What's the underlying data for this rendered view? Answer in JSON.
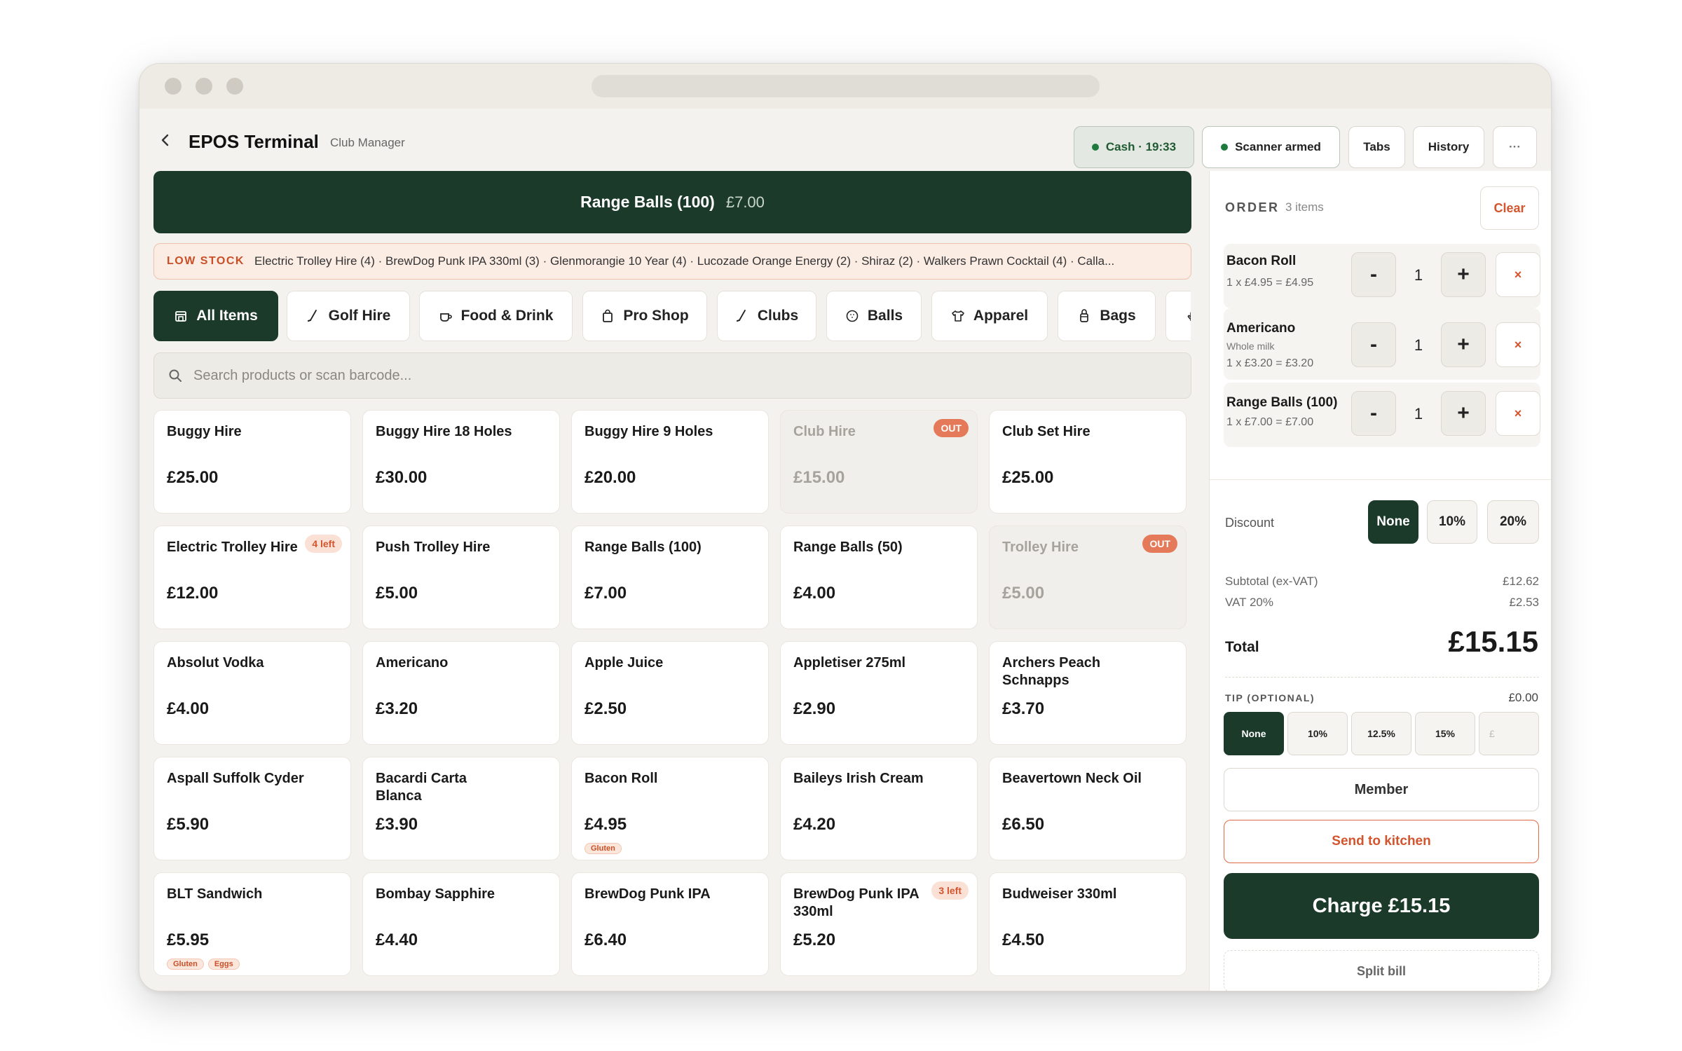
{
  "header": {
    "title": "EPOS Terminal",
    "subtitle": "Club Manager",
    "cash_status": "Cash · 19:33",
    "scanner_status": "Scanner armed",
    "tabs_label": "Tabs",
    "history_label": "History",
    "more_label": "···"
  },
  "hero": {
    "name": "Range Balls (100)",
    "price": "£7.00"
  },
  "low_stock": {
    "label": "LOW STOCK",
    "text": "Electric Trolley Hire (4) · BrewDog Punk IPA 330ml (3) · Glenmorangie 10 Year (4) · Lucozade Orange Energy (2) · Shiraz (2) · Walkers Prawn Cocktail (4) · Calla..."
  },
  "categories": [
    {
      "label": "All Items",
      "icon": "store-icon"
    },
    {
      "label": "Golf Hire",
      "icon": "golf-club-icon"
    },
    {
      "label": "Food & Drink",
      "icon": "cup-icon"
    },
    {
      "label": "Pro Shop",
      "icon": "shopping-bag-icon"
    },
    {
      "label": "Clubs",
      "icon": "golf-club-icon"
    },
    {
      "label": "Balls",
      "icon": "golf-ball-icon"
    },
    {
      "label": "Apparel",
      "icon": "shirt-icon"
    },
    {
      "label": "Bags",
      "icon": "golf-bag-icon"
    },
    {
      "label": "",
      "icon": "glove-icon"
    }
  ],
  "search": {
    "placeholder": "Search products or scan barcode..."
  },
  "products": [
    {
      "name": "Buggy Hire",
      "price": "£25.00"
    },
    {
      "name": "Buggy Hire 18 Holes",
      "price": "£30.00"
    },
    {
      "name": "Buggy Hire 9 Holes",
      "price": "£20.00"
    },
    {
      "name": "Club Hire",
      "price": "£15.00",
      "badge": "OUT"
    },
    {
      "name": "Club Set Hire",
      "price": "£25.00"
    },
    {
      "name": "Electric Trolley Hire",
      "price": "£12.00",
      "badge": "4 left"
    },
    {
      "name": "Push Trolley Hire",
      "price": "£5.00"
    },
    {
      "name": "Range Balls (100)",
      "price": "£7.00"
    },
    {
      "name": "Range Balls (50)",
      "price": "£4.00"
    },
    {
      "name": "Trolley Hire",
      "price": "£5.00",
      "badge": "OUT"
    },
    {
      "name": "Absolut Vodka",
      "price": "£4.00"
    },
    {
      "name": "Americano",
      "price": "£3.20"
    },
    {
      "name": "Apple Juice",
      "price": "£2.50"
    },
    {
      "name": "Appletiser 275ml",
      "price": "£2.90"
    },
    {
      "name": "Archers Peach Schnapps",
      "price": "£3.70"
    },
    {
      "name": "Aspall Suffolk Cyder",
      "price": "£5.90"
    },
    {
      "name": "Bacardi Carta Blanca",
      "price": "£3.90"
    },
    {
      "name": "Bacon Roll",
      "price": "£4.95",
      "tags": [
        "Gluten"
      ]
    },
    {
      "name": "Baileys Irish Cream",
      "price": "£4.20"
    },
    {
      "name": "Beavertown Neck Oil",
      "price": "£6.50"
    },
    {
      "name": "BLT Sandwich",
      "price": "£5.95",
      "tags": [
        "Gluten",
        "Eggs"
      ]
    },
    {
      "name": "Bombay Sapphire",
      "price": "£4.40"
    },
    {
      "name": "BrewDog Punk IPA",
      "price": "£6.40"
    },
    {
      "name": "BrewDog Punk IPA 330ml",
      "price": "£5.20",
      "badge": "3 left"
    },
    {
      "name": "Budweiser 330ml",
      "price": "£4.50"
    }
  ],
  "order": {
    "label": "ORDER",
    "count": "3 items",
    "clear_label": "Clear",
    "items": [
      {
        "name": "Bacon Roll",
        "modifier": "",
        "line": "1 x £4.95 = £4.95",
        "qty": "1"
      },
      {
        "name": "Americano",
        "modifier": "Whole milk",
        "line": "1 x £3.20 = £3.20",
        "qty": "1"
      },
      {
        "name": "Range Balls (100)",
        "modifier": "",
        "line": "1 x £7.00 = £7.00",
        "qty": "1"
      }
    ],
    "minus": "-",
    "plus": "+",
    "remove": "×"
  },
  "discount": {
    "label": "Discount",
    "options": [
      "None",
      "10%",
      "20%"
    ],
    "selected": "None"
  },
  "totals": {
    "subtotal_label": "Subtotal (ex-VAT)",
    "subtotal": "£12.62",
    "vat_label": "VAT 20%",
    "vat": "£2.53",
    "total_label": "Total",
    "total": "£15.15"
  },
  "tip": {
    "label": "TIP (OPTIONAL)",
    "amount": "£0.00",
    "options": [
      "None",
      "10%",
      "12.5%",
      "15%"
    ],
    "custom_placeholder": "£",
    "selected": "None"
  },
  "actions": {
    "member": "Member",
    "send_kitchen": "Send to kitchen",
    "charge": "Charge £15.15",
    "split": "Split bill"
  },
  "colors": {
    "brand": "#1b3a2a",
    "accent": "#d2552e",
    "status_green": "#1f7a3e"
  }
}
